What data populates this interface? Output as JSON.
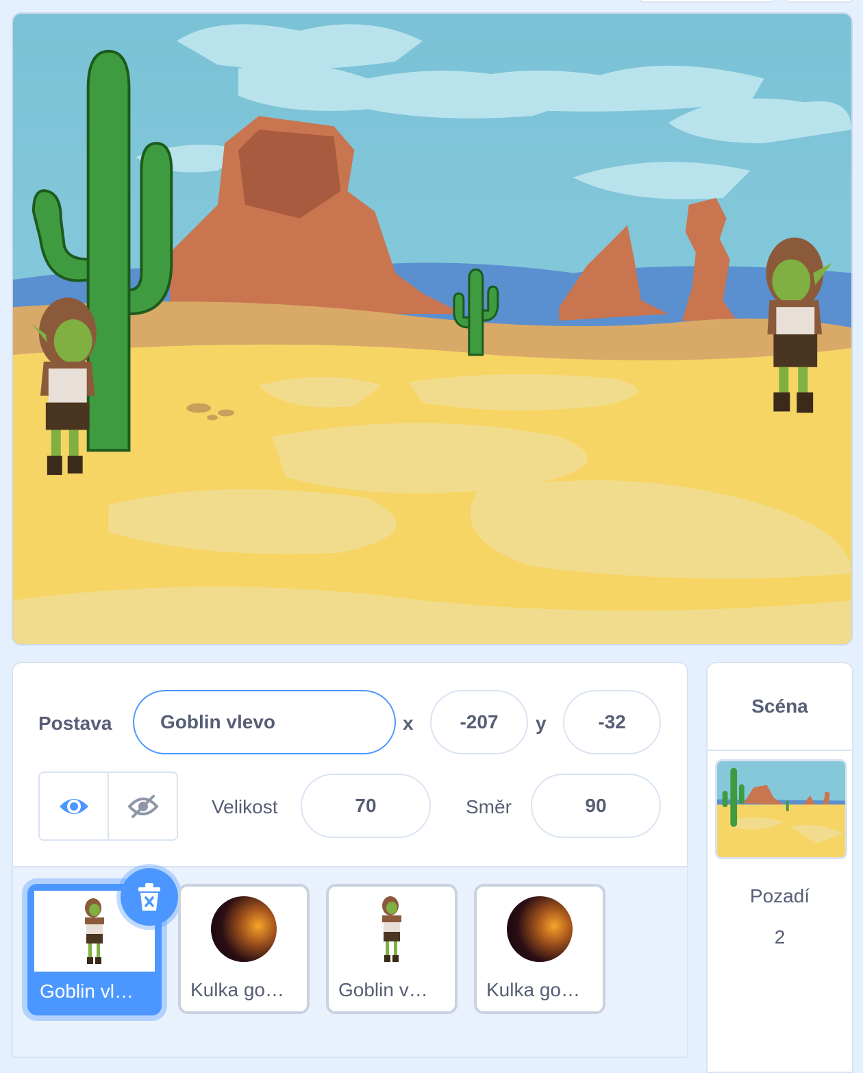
{
  "sprite_info": {
    "sprite_label": "Postava",
    "sprite_name": "Goblin vlevo",
    "x_label": "x",
    "x_value": "-207",
    "y_label": "y",
    "y_value": "-32",
    "size_label": "Velikost",
    "size_value": "70",
    "direction_label": "Směr",
    "direction_value": "90",
    "visible": true
  },
  "sprites": [
    {
      "name": "Goblin vl…",
      "icon": "goblin",
      "selected": true
    },
    {
      "name": "Kulka go…",
      "icon": "orb",
      "selected": false
    },
    {
      "name": "Goblin v…",
      "icon": "goblin",
      "selected": false
    },
    {
      "name": "Kulka go…",
      "icon": "orb",
      "selected": false
    }
  ],
  "stage_panel": {
    "title": "Scéna",
    "backdrops_label": "Pozadí",
    "backdrops_count": "2"
  },
  "colors": {
    "accent": "#4c97ff",
    "text": "#575e75",
    "border": "#d9e3f2"
  }
}
